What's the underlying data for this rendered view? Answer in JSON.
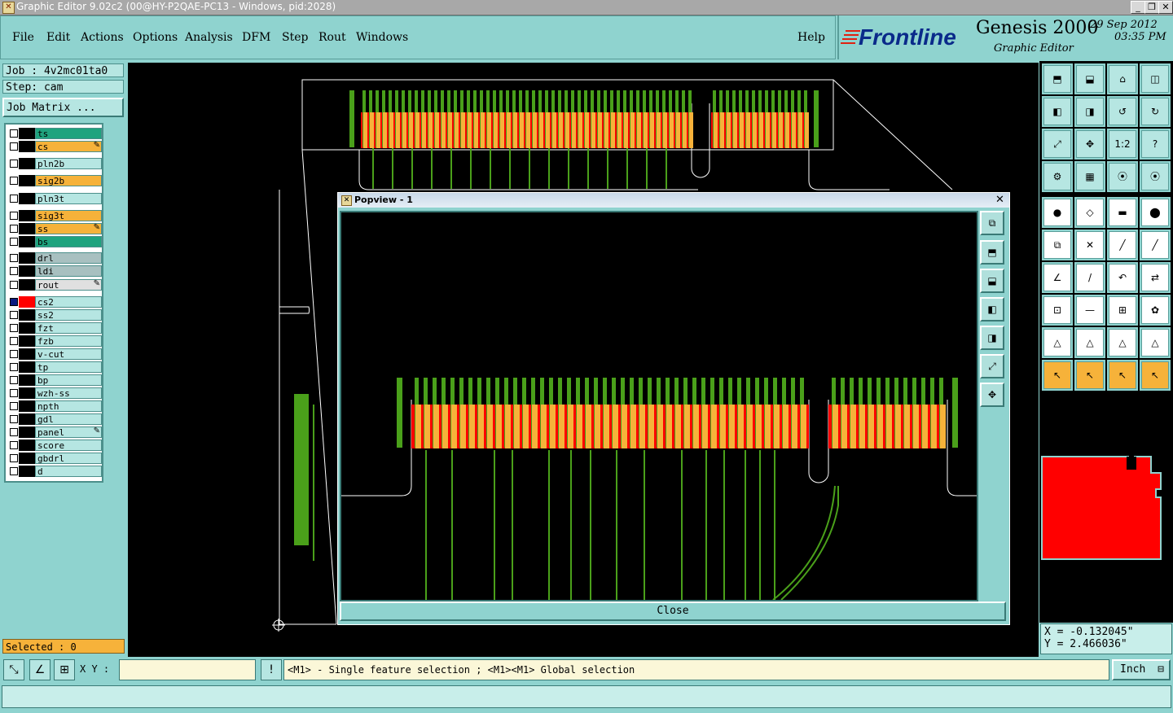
{
  "window": {
    "title": "Graphic Editor 9.02c2 (00@HY-P2QAE-PC13 - Windows, pid:2028)"
  },
  "menu": {
    "items": [
      "File",
      "Edit",
      "Actions",
      "Options",
      "Analysis",
      "DFM",
      "Step",
      "Rout",
      "Windows"
    ],
    "help": "Help"
  },
  "logo": {
    "brand": "Frontline",
    "product": "Genesis 2000",
    "subtitle": "Graphic Editor",
    "date": "29 Sep 2012",
    "time": "03:35 PM"
  },
  "job": {
    "job_label": "Job : 4v2mc01ta0",
    "step_label": "Step: cam",
    "matrix_button": "Job Matrix ..."
  },
  "layers": [
    {
      "name": "ts",
      "color": "#1fa37e"
    },
    {
      "name": "cs",
      "color": "#f6b23a",
      "mark": "✎"
    },
    {
      "name": "pln2b",
      "color": "#b6e6e2"
    },
    {
      "name": "sig2b",
      "color": "#f6b23a"
    },
    {
      "name": "pln3t",
      "color": "#b6e6e2"
    },
    {
      "name": "sig3t",
      "color": "#f6b23a"
    },
    {
      "name": "ss",
      "color": "#f6b23a",
      "mark": "✎"
    },
    {
      "name": "bs",
      "color": "#1fa37e"
    },
    {
      "name": "drl",
      "color": "#a8c0c0"
    },
    {
      "name": "ldi",
      "color": "#a8c0c0"
    },
    {
      "name": "rout",
      "color": "#e0e0e0",
      "mark": "✎"
    },
    {
      "name": "cs2",
      "color": "#b6e6e2"
    },
    {
      "name": "ss2",
      "color": "#b6e6e2"
    },
    {
      "name": "fzt",
      "color": "#b6e6e2"
    },
    {
      "name": "fzb",
      "color": "#b6e6e2"
    },
    {
      "name": "v-cut",
      "color": "#b6e6e2"
    },
    {
      "name": "tp",
      "color": "#b6e6e2"
    },
    {
      "name": "bp",
      "color": "#b6e6e2"
    },
    {
      "name": "wzh-ss",
      "color": "#b6e6e2"
    },
    {
      "name": "npth",
      "color": "#b6e6e2"
    },
    {
      "name": "gdl",
      "color": "#b6e6e2"
    },
    {
      "name": "panel",
      "color": "#b6e6e2",
      "mark": "✎"
    },
    {
      "name": "score",
      "color": "#b6e6e2"
    },
    {
      "name": "gbdrl",
      "color": "#b6e6e2"
    },
    {
      "name": "d",
      "color": "#b6e6e2"
    }
  ],
  "popview": {
    "title": "Popview - 1",
    "close_label": "Close"
  },
  "status": {
    "selected": "Selected : 0",
    "xy_label": "X Y :",
    "xy_value": "",
    "message": "<M1> - Single feature selection ; <M1><M1> Global selection",
    "unit": "Inch",
    "coord_x": "X = -0.132045\"",
    "coord_y": "Y = 2.466036\""
  },
  "colors": {
    "bg": "#8fd3cf",
    "pad": "#f6b23a",
    "copper": "#4aa01a",
    "edge": "#ff0000"
  }
}
